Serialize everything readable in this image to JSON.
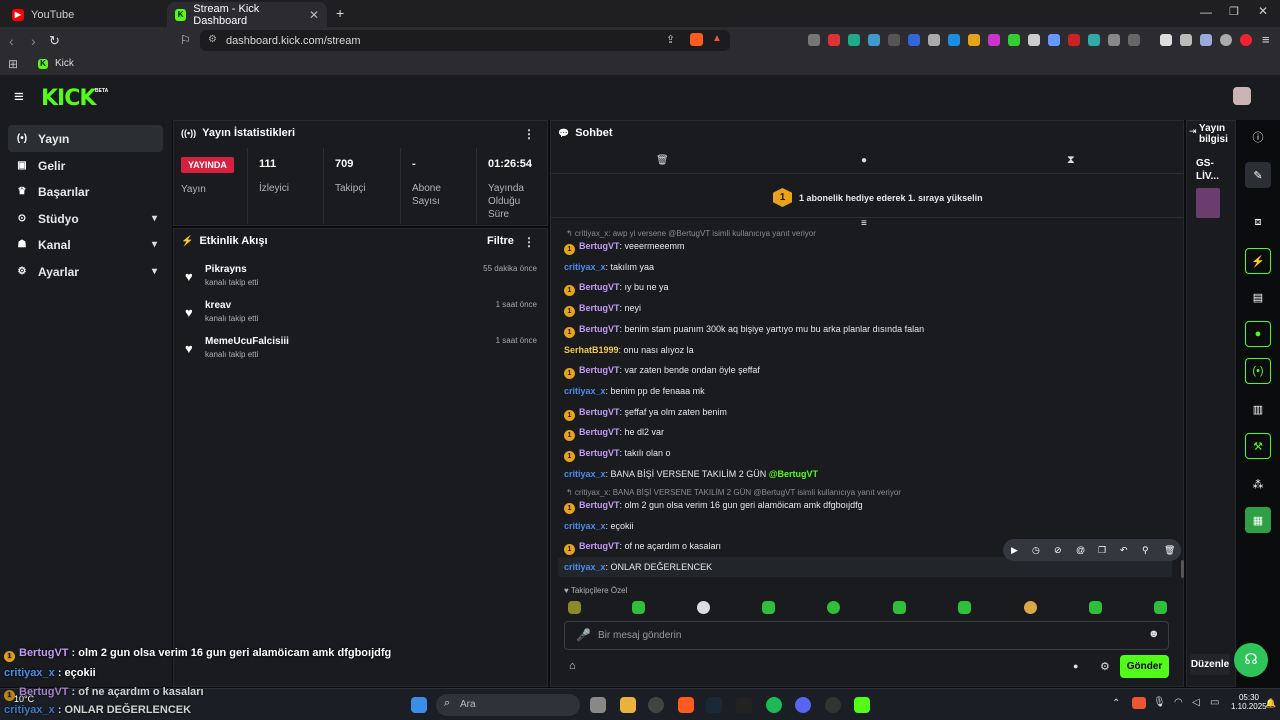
{
  "browser": {
    "tabs": [
      {
        "label": "YouTube"
      },
      {
        "label": "Stream - Kick Dashboard"
      }
    ],
    "url": "dashboard.kick.com/stream",
    "bookmark": "Kick"
  },
  "header": {
    "logo": "KICK",
    "beta": "BETA"
  },
  "sidebar": {
    "items": [
      {
        "label": "Yayın"
      },
      {
        "label": "Gelir"
      },
      {
        "label": "Başarılar"
      },
      {
        "label": "Stüdyo"
      },
      {
        "label": "Kanal"
      },
      {
        "label": "Ayarlar"
      }
    ]
  },
  "stats": {
    "title": "Yayın İstatistikleri",
    "live_badge": "YAYINDA",
    "live_label": "Yayın",
    "cols": [
      {
        "value": "111",
        "label": "İzleyici"
      },
      {
        "value": "709",
        "label": "Takipçi"
      },
      {
        "value": "-",
        "label": "Abone Sayısı"
      },
      {
        "value": "01:26:54",
        "label": "Yayında Olduğu Süre"
      }
    ]
  },
  "activity": {
    "title": "Etkinlik Akışı",
    "filter": "Filtre",
    "items": [
      {
        "name": "Pikrayns",
        "sub": "kanalı takip etti",
        "time": "55 dakika önce"
      },
      {
        "name": "kreav",
        "sub": "kanalı takip etti",
        "time": "1 saat önce"
      },
      {
        "name": "MemeUcuFalcisiii",
        "sub": "kanalı takip etti",
        "time": "1 saat önce"
      }
    ]
  },
  "chat": {
    "title": "Sohbet",
    "promo": "1 abonelik hediye ederek 1. sıraya yükselin",
    "promo_rank": "1",
    "reply1": "↰ critiyax_x: awp yi versene @BertugVT isimli kullanıcıya yanıt veriyor",
    "reply2": "↰ critiyax_x: BANA BİŞİ VERSENE TAKILİM 2 GÜN @BertugVT isimli kullanıcıya yanıt veriyor",
    "messages": [
      {
        "user": "BertugVT",
        "text": ": veeermeeemm"
      },
      {
        "user": "critiyax_x",
        "text": ": takılım yaa"
      },
      {
        "user": "BertugVT",
        "text": ": ıy bu ne ya"
      },
      {
        "user": "BertugVT",
        "text": ": neyi"
      },
      {
        "user": "BertugVT",
        "text": ": benim stam puanım 300k aq bişiye yartıyo mu bu arka planlar dısında falan"
      },
      {
        "user": "SerhatB1999",
        "text": ": onu nası alıyoz la"
      },
      {
        "user": "BertugVT",
        "text": ": var zaten bende ondan öyle şeffaf"
      },
      {
        "user": "critiyax_x",
        "text": ": benim pp de fenaaa mk"
      },
      {
        "user": "BertugVT",
        "text": ": şeffaf ya olm zaten benim"
      },
      {
        "user": "BertugVT",
        "text": ": he dl2 var"
      },
      {
        "user": "BertugVT",
        "text": ": takılı olan o"
      },
      {
        "user": "critiyax_x",
        "text": ": BANA BİŞİ VERSENE TAKILİM 2 GÜN ",
        "mention": "@BertugVT"
      },
      {
        "user": "BertugVT",
        "text": ": olm 2 gun olsa verim 16 gun geri alamöicam amk dfgboıjdfg"
      },
      {
        "user": "critiyax_x",
        "text": ": eçokii"
      },
      {
        "user": "BertugVT",
        "text": ": of ne açardım o kasaları"
      },
      {
        "user": "critiyax_x",
        "text": ": ONLAR DEĞERLENCEK"
      }
    ],
    "followers_only": "Takipçilere Özel",
    "input_placeholder": "Bir mesaj gönderin",
    "send": "Gönder"
  },
  "stream_info": {
    "title": "Yayın bilgisi",
    "name": "GS-LİV..."
  },
  "edit_label": "Düzenle",
  "overlay": [
    {
      "user": "BertugVT",
      "text": " : olm 2 gun olsa verim 16 gun geri alamöicam amk dfgboıjdfg"
    },
    {
      "user": "critiyax_x",
      "text": " : eçokii"
    },
    {
      "user": "BertugVT",
      "text": " : of ne açardım o kasaları"
    },
    {
      "user": "critiyax_x",
      "text": " : ONLAR DEĞERLENCEK"
    }
  ],
  "taskbar": {
    "search": "Ara",
    "weather": "10°C",
    "time": "05:30",
    "date": "1.10.2025"
  },
  "colors": {
    "brand": "#53fc18",
    "live": "#d6203f",
    "sub_badge": "#e8a316"
  }
}
